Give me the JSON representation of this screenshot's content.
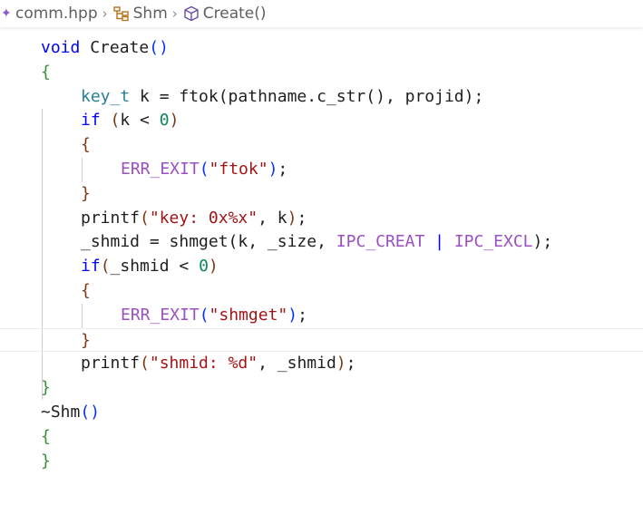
{
  "breadcrumb": {
    "file": "comm.hpp",
    "class_name": "Shm",
    "method": "Create()",
    "icons": [
      "file-modified-dot-icon",
      "chevron-right-icon",
      "class-icon",
      "chevron-right-icon",
      "method-cube-icon"
    ]
  },
  "code": {
    "signature": {
      "keyword": "void",
      "name": "Create",
      "parens": "()"
    },
    "open_brace": "{",
    "l1": {
      "type": "key_t",
      "rest1": " k = ftok(pathname.c_str(), projid);"
    },
    "l2": {
      "kw": "if",
      "sp": " ",
      "p1": "(",
      "mid": "k < ",
      "num": "0",
      "p2": ")"
    },
    "l3": "{",
    "l4": {
      "macro": "ERR_EXIT",
      "p1": "(",
      "str": "\"ftok\"",
      "p2": ")",
      "end": ";"
    },
    "l5": "}",
    "l6": {
      "fn": "printf",
      "p1": "(",
      "str": "\"key: 0x%x\"",
      "mid": ", k",
      "p2": ")",
      "end": ";"
    },
    "l7": {
      "pre": "_shmid = shmget(k, _size, ",
      "m1": "IPC_CREAT",
      "bar": " | ",
      "m2": "IPC_EXCL",
      "post": ");"
    },
    "l8": {
      "kw": "if",
      "p1": "(",
      "mid": "_shmid < ",
      "num": "0",
      "p2": ")"
    },
    "l9": "{",
    "l10": {
      "macro": "ERR_EXIT",
      "p1": "(",
      "str": "\"shmget\"",
      "p2": ")",
      "end": ";"
    },
    "l11": "}",
    "l12": {
      "fn": "printf",
      "p1": "(",
      "str": "\"shmid: %d\"",
      "mid": ", _shmid",
      "p2": ")",
      "end": ";"
    },
    "close_brace": "}",
    "dtor": {
      "name": "~Shm",
      "parens": "()"
    },
    "dtor_open": "{",
    "dtor_close": "}"
  },
  "colors": {
    "keyword": "#0000ff",
    "type": "#267f99",
    "macro": "#9b4fc2",
    "string": "#a31515",
    "number": "#098658"
  }
}
